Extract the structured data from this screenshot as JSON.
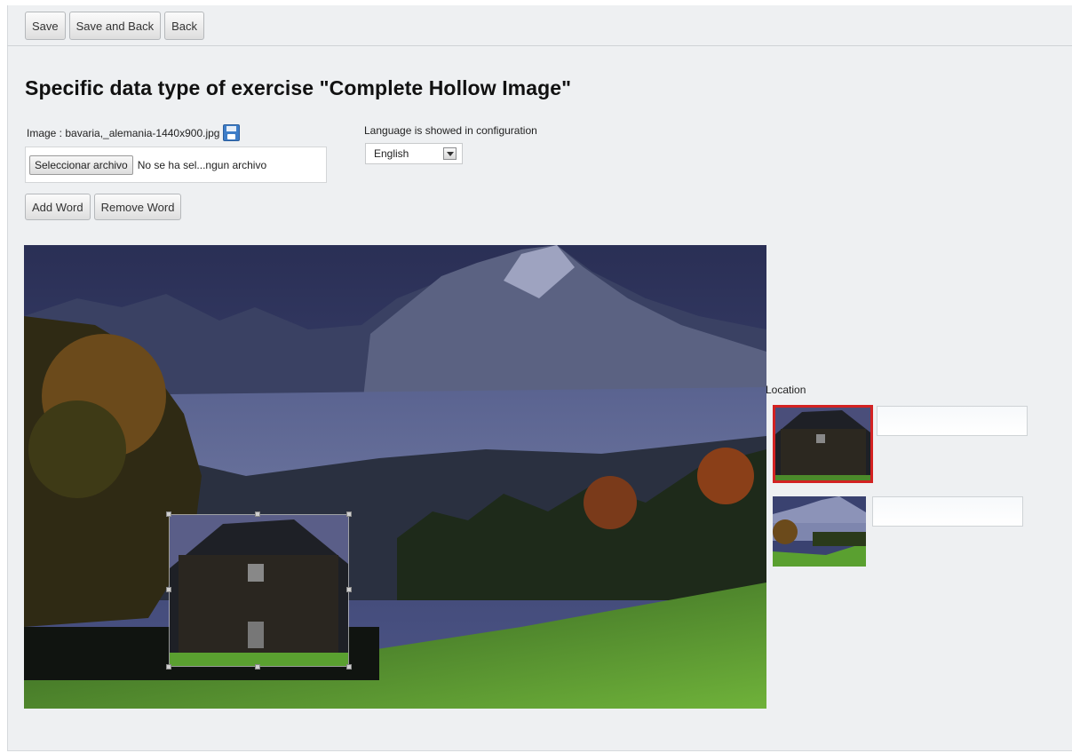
{
  "toolbar": {
    "save_label": "Save",
    "save_and_back_label": "Save and Back",
    "back_label": "Back"
  },
  "page": {
    "title": "Specific data type of exercise \"Complete Hollow Image\""
  },
  "image_field": {
    "label": "Image : bavaria,_alemania-1440x900.jpg",
    "icon": "save-icon",
    "file_button_label": "Seleccionar archivo",
    "file_status": "No se ha sel...ngun archivo"
  },
  "language": {
    "label": "Language is showed in configuration",
    "selected": "English"
  },
  "word_buttons": {
    "add_label": "Add Word",
    "remove_label": "Remove Word"
  },
  "location": {
    "label": "Location",
    "words": [
      {
        "value": "",
        "selected": true
      },
      {
        "value": "",
        "selected": false
      }
    ]
  },
  "colors": {
    "selected_border": "#d32222",
    "page_background": "#eef0f2"
  }
}
